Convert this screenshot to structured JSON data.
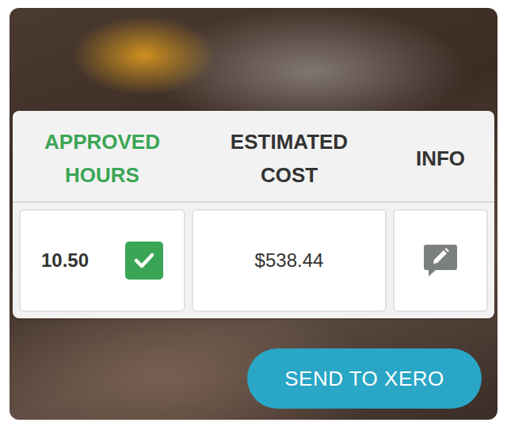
{
  "table": {
    "columns": [
      {
        "label": "APPROVED HOURS",
        "highlighted": true
      },
      {
        "label": "ESTIMATED COST",
        "highlighted": false
      },
      {
        "label": "INFO",
        "highlighted": false
      }
    ],
    "rows": [
      {
        "hours": "10.50",
        "approved": true,
        "cost": "$538.44"
      }
    ]
  },
  "buttons": [
    "SEND TO XERO"
  ]
}
